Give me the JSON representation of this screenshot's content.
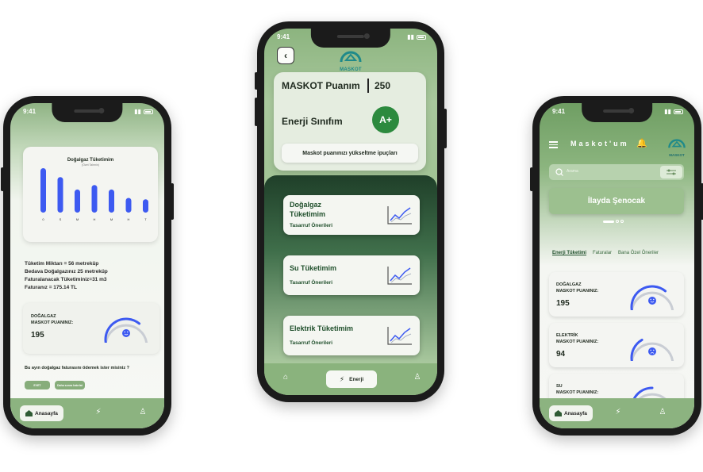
{
  "status_time": "9:41",
  "phone1": {
    "chart_data": {
      "type": "bar",
      "title": "Doğalgaz Tüketimim",
      "subtitle": "(Özet Tahmin)",
      "categories": [
        "0",
        "S",
        "M",
        "H",
        "M",
        "H",
        "T"
      ],
      "values": [
        100,
        80,
        52,
        62,
        52,
        33,
        30
      ],
      "ylim": [
        0,
        100
      ],
      "color": "#3d5af1"
    },
    "info": {
      "line1": "Tüketim Miktarı = 56 metreküp",
      "line2": "Bedava Doğalgazınız 25 metreküp",
      "line3": "Faturalanacak Tüketiminiz=31 m3",
      "line4": "Faturanız = 175.14 TL"
    },
    "score": {
      "label1": "DOĞALGAZ",
      "label2": "MASKOT PUANINIZ:",
      "value": "195",
      "level": 0.7
    },
    "question": "Bu ayın doğalgaz faturasını ödemek ister misiniz ?",
    "yes_label": "EVET",
    "later_label": "Daha sonra hatırlat",
    "nav_home": "Anasayfa"
  },
  "phone2": {
    "logo": "MASKOT",
    "points_title": "MASKOT Puanım",
    "points_value": "250",
    "energy_class_label": "Enerji Sınıfım",
    "energy_class": "A+",
    "tips_button": "Maskot puanınızı yükseltme ipuçları",
    "cards": [
      {
        "title_line1": "Doğalgaz",
        "title_line2": "Tüketimim",
        "subtitle": "Tasarruf Önerileri"
      },
      {
        "title_line1": "Su Tüketimim",
        "title_line2": "",
        "subtitle": "Tasarruf Önerileri"
      },
      {
        "title_line1": "Elektrik Tüketimim",
        "title_line2": "",
        "subtitle": "Tasarruf Önerileri"
      }
    ],
    "nav_active": "Enerji"
  },
  "phone3": {
    "title": "Maskot'um",
    "logo": "MASKOT",
    "search_placeholder": "Arama",
    "user_name": "İlayda Şenocak",
    "tabs": [
      "Enerji Tüketimi",
      "Faturalar",
      "Bana Özel Öneriler"
    ],
    "scores": [
      {
        "label1": "DOĞALGAZ",
        "label2": "MASKOT PUANINIZ:",
        "value": "195",
        "mood": "happy",
        "level": 0.7
      },
      {
        "label1": "ELEKTRİK",
        "label2": "MASKOT PUANINIZ:",
        "value": "94",
        "mood": "sad",
        "level": 0.35
      },
      {
        "label1": "SU",
        "label2": "MASKOT PUANINIZ:",
        "value": "",
        "mood": "neutral",
        "level": 0.5
      }
    ],
    "nav_home": "Anasayfa"
  }
}
